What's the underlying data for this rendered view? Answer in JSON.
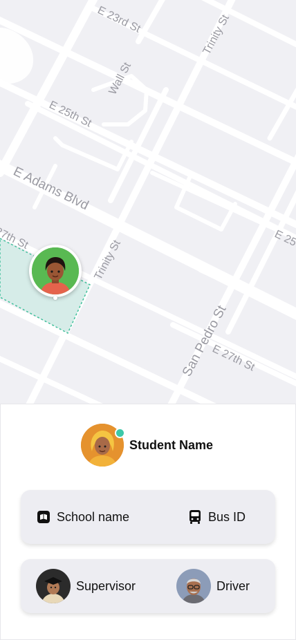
{
  "map": {
    "streets": {
      "e23rd": "E 23rd St",
      "trinity_top": "Trinity St",
      "wall": "Wall St",
      "e25th": "E 25th St",
      "adams": "E Adams Blvd",
      "e27th_left": "27th St",
      "trinity_mid": "Trinity St",
      "san_pedro": "San Pedro St",
      "e27th_right": "E 27th St",
      "e25th_right": "E 25"
    },
    "colors": {
      "background": "#f0f0f4",
      "road": "#ffffff",
      "zone": "#d6ece8",
      "zone_border": "#3fbf9a"
    }
  },
  "student": {
    "name": "Student Name",
    "status_color": "#3cc8a8"
  },
  "card1": {
    "school": {
      "icon": "book-icon",
      "label": "School name"
    },
    "bus": {
      "icon": "bus-icon",
      "label": "Bus ID"
    }
  },
  "card2": {
    "supervisor": {
      "icon": "supervisor-avatar",
      "label": "Supervisor"
    },
    "driver": {
      "icon": "driver-avatar",
      "label": "Driver"
    }
  }
}
